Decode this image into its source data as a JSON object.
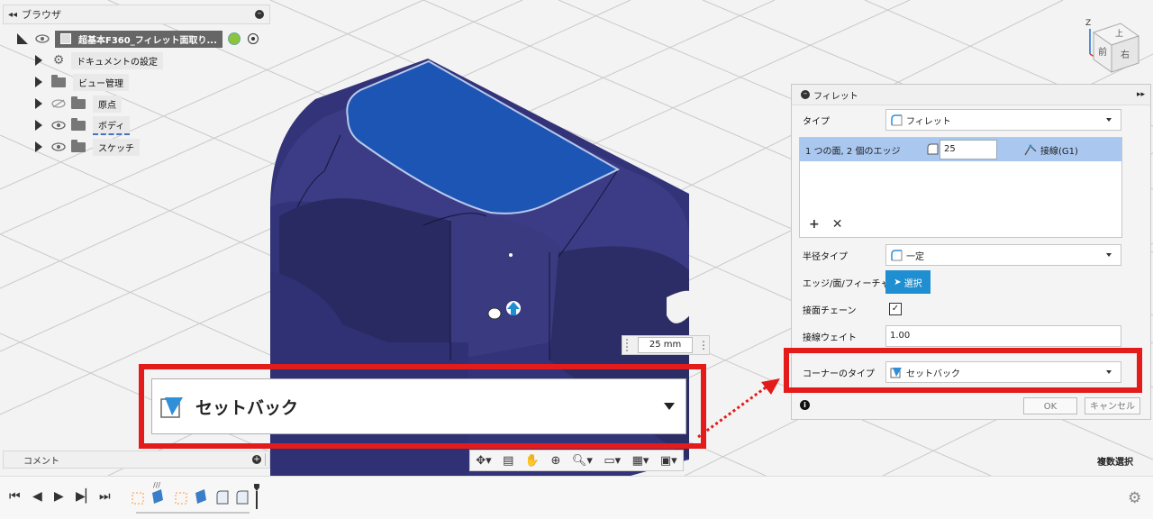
{
  "browser": {
    "title": "ブラウザ",
    "root_label": "超基本F360_フィレット面取り...",
    "items": [
      {
        "label": "ドキュメントの設定",
        "icon": "gear-icon"
      },
      {
        "label": "ビュー管理",
        "icon": "folder-icon"
      },
      {
        "label": "原点",
        "icon": "folder-icon",
        "hidden": true
      },
      {
        "label": "ボディ",
        "icon": "folder-icon"
      },
      {
        "label": "スケッチ",
        "icon": "folder-icon"
      }
    ]
  },
  "comments": {
    "title": "コメント"
  },
  "dimension": {
    "value": "25 mm"
  },
  "viewcube": {
    "front": "前",
    "right": "右",
    "top": "上",
    "z": "Z"
  },
  "dialog": {
    "title": "フィレット",
    "type_label": "タイプ",
    "type_value": "フィレット",
    "selection_label": "1 つの面, 2 個のエッジ",
    "radius_value": "25",
    "continuity_value": "接線(G1)",
    "radius_type_label": "半径タイプ",
    "radius_type_value": "一定",
    "edge_label": "エッジ/面/フィーチャ",
    "select_button": "選択",
    "tangent_chain_label": "接面チェーン",
    "tangent_chain_checked": true,
    "tangent_weight_label": "接線ウェイト",
    "tangent_weight_value": "1.00",
    "corner_type_label": "コーナーのタイプ",
    "corner_type_value": "セットバック",
    "ok": "OK",
    "cancel": "キャンセル"
  },
  "zoom_callout": {
    "value": "セットバック"
  },
  "status": {
    "multi_select": "複数選択"
  },
  "colors": {
    "highlight_red": "#e31b1b",
    "face_blue": "#1d55b5",
    "body": "#2f2f6e",
    "select_blue": "#1f8fd1"
  }
}
